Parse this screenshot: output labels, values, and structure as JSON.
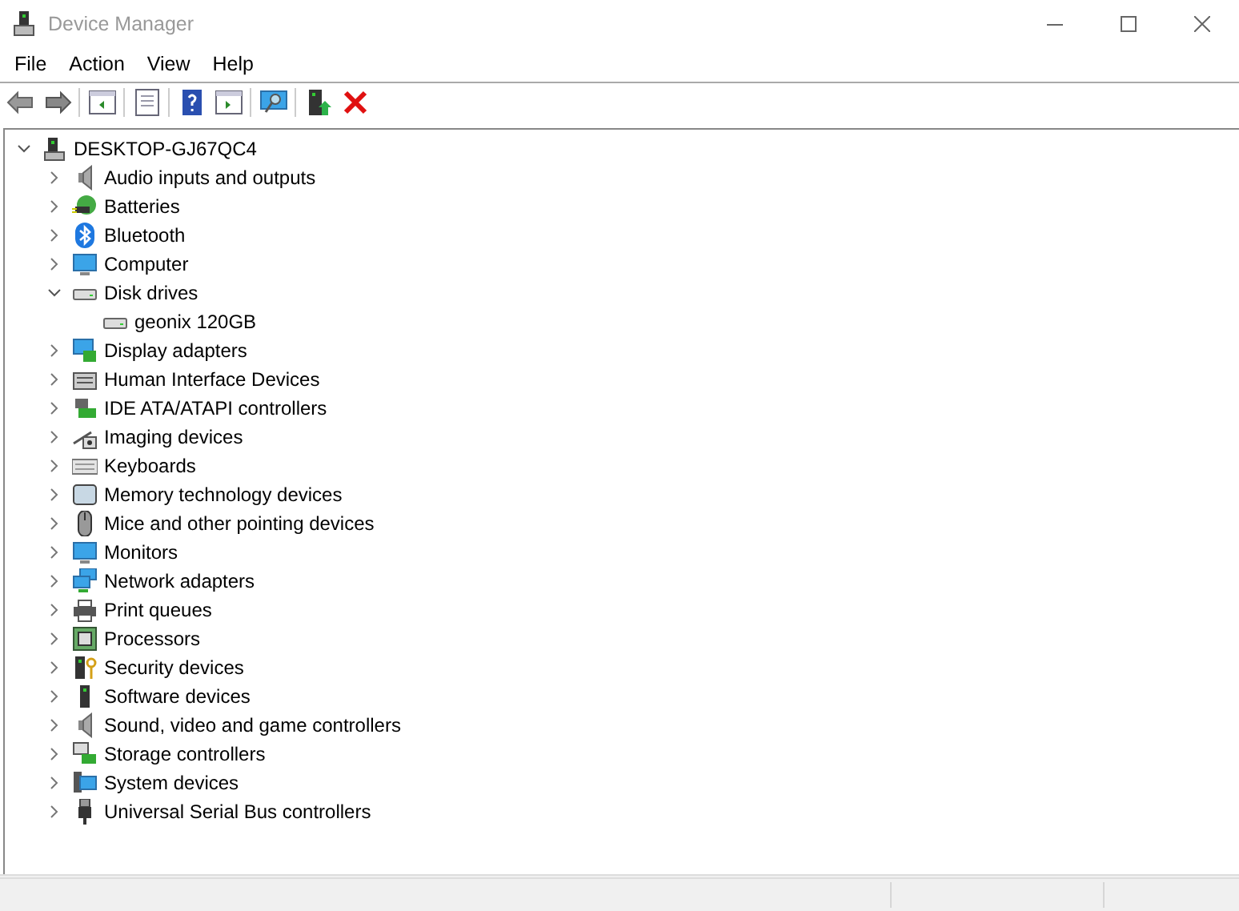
{
  "window": {
    "title": "Device Manager"
  },
  "menu": [
    "File",
    "Action",
    "View",
    "Help"
  ],
  "tree": [
    {
      "label": "DESKTOP-GJ67QC4",
      "expanded": true,
      "children": [
        {
          "label": "Audio inputs and outputs",
          "expanded": false
        },
        {
          "label": "Batteries",
          "expanded": false
        },
        {
          "label": "Bluetooth",
          "expanded": false
        },
        {
          "label": "Computer",
          "expanded": false
        },
        {
          "label": "Disk drives",
          "expanded": true,
          "children": [
            {
              "label": "geonix 120GB"
            }
          ]
        },
        {
          "label": "Display adapters",
          "expanded": false
        },
        {
          "label": "Human Interface Devices",
          "expanded": false
        },
        {
          "label": "IDE ATA/ATAPI controllers",
          "expanded": false
        },
        {
          "label": "Imaging devices",
          "expanded": false
        },
        {
          "label": "Keyboards",
          "expanded": false
        },
        {
          "label": "Memory technology devices",
          "expanded": false
        },
        {
          "label": "Mice and other pointing devices",
          "expanded": false
        },
        {
          "label": "Monitors",
          "expanded": false
        },
        {
          "label": "Network adapters",
          "expanded": false
        },
        {
          "label": "Print queues",
          "expanded": false
        },
        {
          "label": "Processors",
          "expanded": false
        },
        {
          "label": "Security devices",
          "expanded": false
        },
        {
          "label": "Software devices",
          "expanded": false
        },
        {
          "label": "Sound, video and game controllers",
          "expanded": false
        },
        {
          "label": "Storage controllers",
          "expanded": false
        },
        {
          "label": "System devices",
          "expanded": false
        },
        {
          "label": "Universal Serial Bus controllers",
          "expanded": false
        }
      ]
    }
  ]
}
